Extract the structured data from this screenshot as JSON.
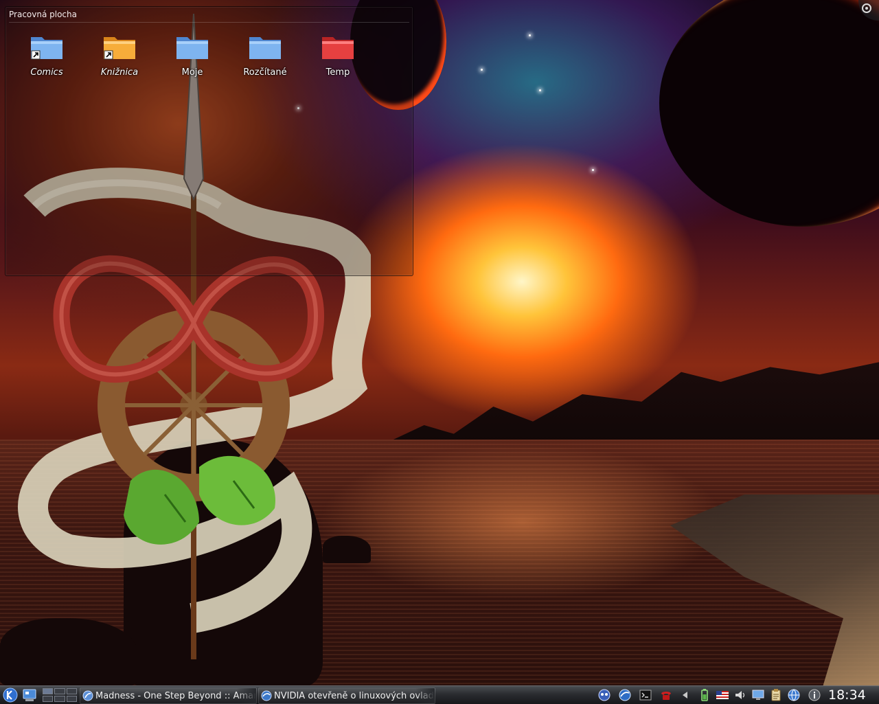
{
  "desktop": {
    "folderview": {
      "title": "Pracovná plocha",
      "items": [
        {
          "label": "Comics",
          "icon": "folder-blue-link-icon",
          "italic": true
        },
        {
          "label": "Knižnica",
          "icon": "folder-orange-link-icon",
          "italic": true
        },
        {
          "label": "Moje",
          "icon": "folder-blue-icon",
          "italic": false
        },
        {
          "label": "Rozčítané",
          "icon": "folder-blue-icon",
          "italic": false
        },
        {
          "label": "Temp",
          "icon": "folder-red-icon",
          "italic": false
        }
      ]
    },
    "toolbox_icon": "cashew-toolbox-icon"
  },
  "taskbar": {
    "launcher_icon": "kde-kickoff-icon",
    "show_desktop_icon": "show-desktop-icon",
    "pager_desktops": 6,
    "pager_active": 1,
    "tasks": [
      {
        "label": "Madness - One Step Beyond  ::  Amar",
        "icon": "amarok-icon"
      },
      {
        "label": "NVIDIA otevřeně o linuxových ovladačí",
        "icon": "konqueror-icon"
      }
    ],
    "tray_icons": [
      "kopete-icon",
      "konqueror-globe-icon",
      "terminal-icon",
      "phone-icon",
      "arrow-left-icon",
      "battery-icon",
      "us-flag-keyboard-icon",
      "volume-icon",
      "display-icon",
      "klipper-icon",
      "network-globe-icon",
      "info-icon"
    ],
    "clock": "18:34"
  },
  "colors": {
    "folder_blue": "#6fa8e8",
    "folder_orange": "#f5a32e",
    "folder_red": "#e23a3a",
    "panel_dark": "#1e1f22"
  }
}
